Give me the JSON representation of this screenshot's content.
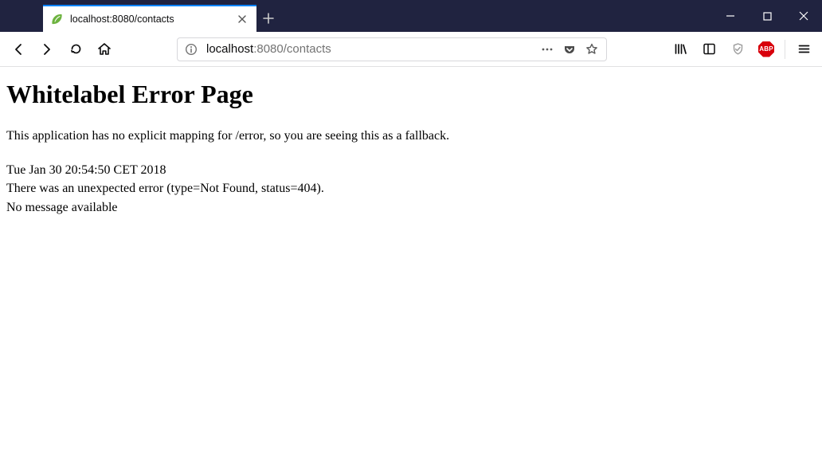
{
  "window": {
    "tab_title": "localhost:8080/contacts"
  },
  "urlbar": {
    "host": "localhost",
    "port_path": ":8080/contacts"
  },
  "extensions": {
    "abp_label": "ABP"
  },
  "page": {
    "heading": "Whitelabel Error Page",
    "fallback_msg": "This application has no explicit mapping for /error, so you are seeing this as a fallback.",
    "timestamp": "Tue Jan 30 20:54:50 CET 2018",
    "error_line": "There was an unexpected error (type=Not Found, status=404).",
    "detail": "No message available"
  }
}
